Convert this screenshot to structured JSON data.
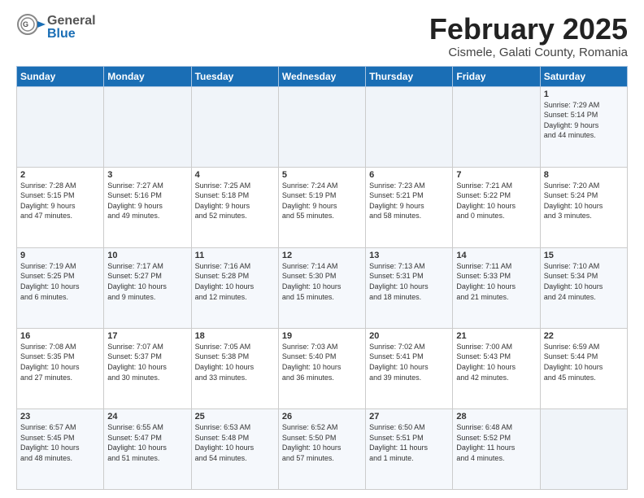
{
  "header": {
    "logo_general": "General",
    "logo_blue": "Blue",
    "month_title": "February 2025",
    "subtitle": "Cismele, Galati County, Romania"
  },
  "weekdays": [
    "Sunday",
    "Monday",
    "Tuesday",
    "Wednesday",
    "Thursday",
    "Friday",
    "Saturday"
  ],
  "weeks": [
    [
      {
        "day": "",
        "info": ""
      },
      {
        "day": "",
        "info": ""
      },
      {
        "day": "",
        "info": ""
      },
      {
        "day": "",
        "info": ""
      },
      {
        "day": "",
        "info": ""
      },
      {
        "day": "",
        "info": ""
      },
      {
        "day": "1",
        "info": "Sunrise: 7:29 AM\nSunset: 5:14 PM\nDaylight: 9 hours\nand 44 minutes."
      }
    ],
    [
      {
        "day": "2",
        "info": "Sunrise: 7:28 AM\nSunset: 5:15 PM\nDaylight: 9 hours\nand 47 minutes."
      },
      {
        "day": "3",
        "info": "Sunrise: 7:27 AM\nSunset: 5:16 PM\nDaylight: 9 hours\nand 49 minutes."
      },
      {
        "day": "4",
        "info": "Sunrise: 7:25 AM\nSunset: 5:18 PM\nDaylight: 9 hours\nand 52 minutes."
      },
      {
        "day": "5",
        "info": "Sunrise: 7:24 AM\nSunset: 5:19 PM\nDaylight: 9 hours\nand 55 minutes."
      },
      {
        "day": "6",
        "info": "Sunrise: 7:23 AM\nSunset: 5:21 PM\nDaylight: 9 hours\nand 58 minutes."
      },
      {
        "day": "7",
        "info": "Sunrise: 7:21 AM\nSunset: 5:22 PM\nDaylight: 10 hours\nand 0 minutes."
      },
      {
        "day": "8",
        "info": "Sunrise: 7:20 AM\nSunset: 5:24 PM\nDaylight: 10 hours\nand 3 minutes."
      }
    ],
    [
      {
        "day": "9",
        "info": "Sunrise: 7:19 AM\nSunset: 5:25 PM\nDaylight: 10 hours\nand 6 minutes."
      },
      {
        "day": "10",
        "info": "Sunrise: 7:17 AM\nSunset: 5:27 PM\nDaylight: 10 hours\nand 9 minutes."
      },
      {
        "day": "11",
        "info": "Sunrise: 7:16 AM\nSunset: 5:28 PM\nDaylight: 10 hours\nand 12 minutes."
      },
      {
        "day": "12",
        "info": "Sunrise: 7:14 AM\nSunset: 5:30 PM\nDaylight: 10 hours\nand 15 minutes."
      },
      {
        "day": "13",
        "info": "Sunrise: 7:13 AM\nSunset: 5:31 PM\nDaylight: 10 hours\nand 18 minutes."
      },
      {
        "day": "14",
        "info": "Sunrise: 7:11 AM\nSunset: 5:33 PM\nDaylight: 10 hours\nand 21 minutes."
      },
      {
        "day": "15",
        "info": "Sunrise: 7:10 AM\nSunset: 5:34 PM\nDaylight: 10 hours\nand 24 minutes."
      }
    ],
    [
      {
        "day": "16",
        "info": "Sunrise: 7:08 AM\nSunset: 5:35 PM\nDaylight: 10 hours\nand 27 minutes."
      },
      {
        "day": "17",
        "info": "Sunrise: 7:07 AM\nSunset: 5:37 PM\nDaylight: 10 hours\nand 30 minutes."
      },
      {
        "day": "18",
        "info": "Sunrise: 7:05 AM\nSunset: 5:38 PM\nDaylight: 10 hours\nand 33 minutes."
      },
      {
        "day": "19",
        "info": "Sunrise: 7:03 AM\nSunset: 5:40 PM\nDaylight: 10 hours\nand 36 minutes."
      },
      {
        "day": "20",
        "info": "Sunrise: 7:02 AM\nSunset: 5:41 PM\nDaylight: 10 hours\nand 39 minutes."
      },
      {
        "day": "21",
        "info": "Sunrise: 7:00 AM\nSunset: 5:43 PM\nDaylight: 10 hours\nand 42 minutes."
      },
      {
        "day": "22",
        "info": "Sunrise: 6:59 AM\nSunset: 5:44 PM\nDaylight: 10 hours\nand 45 minutes."
      }
    ],
    [
      {
        "day": "23",
        "info": "Sunrise: 6:57 AM\nSunset: 5:45 PM\nDaylight: 10 hours\nand 48 minutes."
      },
      {
        "day": "24",
        "info": "Sunrise: 6:55 AM\nSunset: 5:47 PM\nDaylight: 10 hours\nand 51 minutes."
      },
      {
        "day": "25",
        "info": "Sunrise: 6:53 AM\nSunset: 5:48 PM\nDaylight: 10 hours\nand 54 minutes."
      },
      {
        "day": "26",
        "info": "Sunrise: 6:52 AM\nSunset: 5:50 PM\nDaylight: 10 hours\nand 57 minutes."
      },
      {
        "day": "27",
        "info": "Sunrise: 6:50 AM\nSunset: 5:51 PM\nDaylight: 11 hours\nand 1 minute."
      },
      {
        "day": "28",
        "info": "Sunrise: 6:48 AM\nSunset: 5:52 PM\nDaylight: 11 hours\nand 4 minutes."
      },
      {
        "day": "",
        "info": ""
      }
    ]
  ]
}
